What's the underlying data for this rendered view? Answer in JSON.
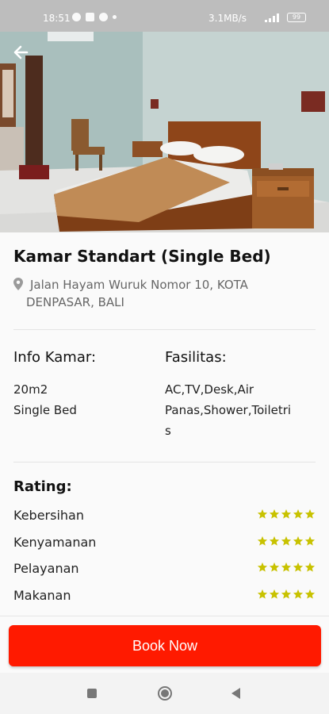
{
  "status_bar": {
    "time": "18:51",
    "network_speed": "3.1MB/s",
    "battery": "99",
    "icons": [
      "whatsapp-icon",
      "chat-icon",
      "game-icon",
      "dot-icon",
      "alarm-icon",
      "volte-icon",
      "wifi-icon",
      "signal-icon",
      "battery-icon"
    ]
  },
  "hero": {
    "image_description_name": "hotel-room-photo",
    "back_icon": "arrow-left-icon"
  },
  "room": {
    "title": "Kamar Standart (Single Bed)",
    "address": "Jalan Hayam Wuruk Nomor 10, KOTA DENPASAR, BALI",
    "info_heading": "Info Kamar:",
    "info_lines": [
      "20m2",
      "Single Bed"
    ],
    "facilities_heading": "Fasilitas:",
    "facilities_lines": [
      "AC,TV,Desk,Air",
      "Panas,Shower,Toiletri",
      "s"
    ]
  },
  "rating": {
    "heading": "Rating:",
    "star_color": "#c8c200",
    "items": [
      {
        "label": "Kebersihan",
        "stars": 5
      },
      {
        "label": "Kenyamanan",
        "stars": 5
      },
      {
        "label": "Pelayanan",
        "stars": 5
      },
      {
        "label": "Makanan",
        "stars": 5
      }
    ]
  },
  "actions": {
    "book_label": "Book Now",
    "book_color": "#ff1a00"
  },
  "nav_bar": {
    "icons": [
      "recent-apps-icon",
      "home-icon",
      "back-triangle-icon"
    ]
  }
}
